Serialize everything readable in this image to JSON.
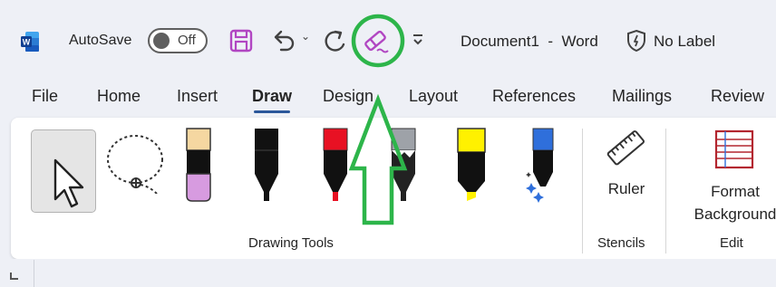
{
  "titlebar": {
    "autosave_label": "AutoSave",
    "autosave_state": "Off",
    "document_title": "Document1  -  Word",
    "sensitivity_label": "No Label",
    "icons": [
      "word-logo-icon",
      "save-icon",
      "undo-icon",
      "redo-icon",
      "eraser-icon",
      "customize-toolbar-icon",
      "shield-icon"
    ]
  },
  "tabs": [
    "File",
    "Home",
    "Insert",
    "Draw",
    "Design",
    "Layout",
    "References",
    "Mailings",
    "Review"
  ],
  "active_tab": "Draw",
  "ribbon": {
    "drawing_tools": {
      "label": "Drawing Tools",
      "tools": [
        "select-tool",
        "lasso-select-tool",
        "pencil-pink",
        "pen-black",
        "pen-red",
        "pen-galaxy-gray",
        "highlighter-yellow",
        "pen-blue-glitter"
      ]
    },
    "stencils": {
      "label": "Stencils",
      "ruler_label": "Ruler"
    },
    "edit": {
      "label": "Edit",
      "format_background_label": "Format\nBackground"
    }
  },
  "colors": {
    "accent": "#2b579a",
    "annotation": "#2db54a",
    "save_icon": "#b146c2",
    "eraser_icon": "#b146c2",
    "pen_red": "#e81123",
    "highlighter": "#fff100",
    "pen_blue": "#2f6fdb"
  }
}
